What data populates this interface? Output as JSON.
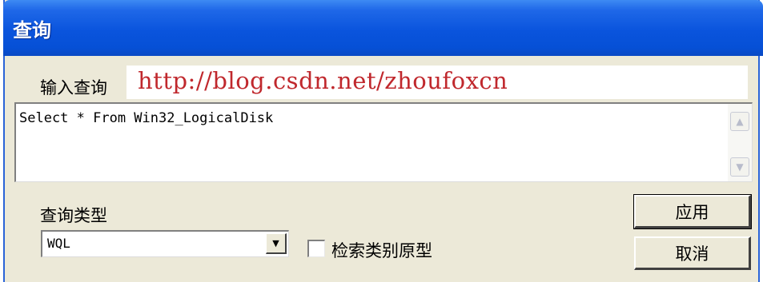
{
  "window": {
    "title": "查询"
  },
  "query": {
    "label": "输入查询",
    "watermark_url": "http://blog.csdn.net/zhoufoxcn",
    "text": "Select * From Win32_LogicalDisk"
  },
  "scrollbar": {
    "up_icon": "chevron-up-icon",
    "down_icon": "chevron-down-icon"
  },
  "query_type": {
    "label": "查询类型",
    "selected": "WQL"
  },
  "checkbox": {
    "label": "检索类别原型",
    "checked": false
  },
  "buttons": {
    "apply": "应用",
    "cancel": "取消"
  },
  "colors": {
    "titlebar": "#0a54dd",
    "dialog_bg": "#ece9d8",
    "watermark": "#c0282d"
  }
}
